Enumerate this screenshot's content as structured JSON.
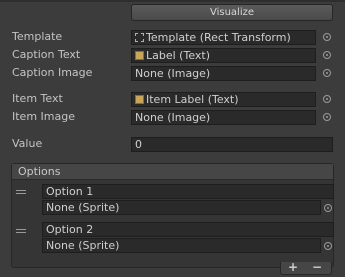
{
  "buttons": {
    "visualize": "Visualize"
  },
  "fields": [
    {
      "label": "Template",
      "value": "Template (Rect Transform)",
      "icon": "rect-transform-icon"
    },
    {
      "label": "Caption Text",
      "value": "Label (Text)",
      "icon": "text-component-icon"
    },
    {
      "label": "Caption Image",
      "value": "None (Image)"
    },
    {
      "label": "Item Text",
      "value": "Item Label (Text)",
      "icon": "text-component-icon"
    },
    {
      "label": "Item Image",
      "value": "None (Image)"
    },
    {
      "label": "Value",
      "value": "0"
    }
  ],
  "options": {
    "title": "Options",
    "items": [
      {
        "text": "Option 1",
        "sprite": "None (Sprite)"
      },
      {
        "text": "Option 2",
        "sprite": "None (Sprite)"
      }
    ],
    "add_label": "+",
    "remove_label": "−"
  }
}
